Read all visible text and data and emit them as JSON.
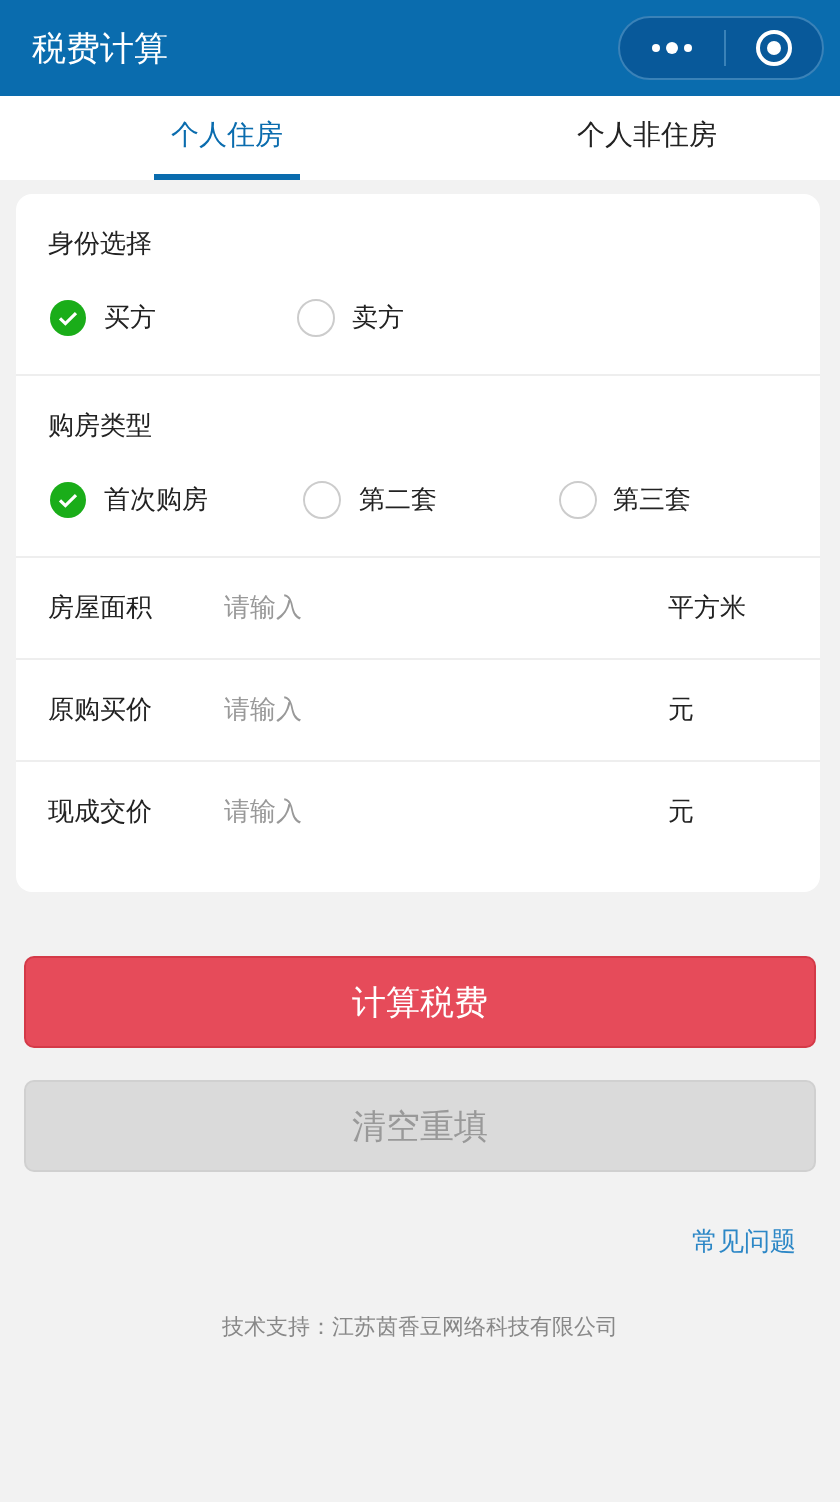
{
  "header": {
    "title": "税费计算"
  },
  "tabs": [
    {
      "label": "个人住房",
      "selected": true
    },
    {
      "label": "个人非住房",
      "selected": false
    }
  ],
  "radio_groups": [
    {
      "title": "身份选择",
      "options": [
        {
          "label": "买方",
          "selected": true
        },
        {
          "label": "卖方",
          "selected": false
        }
      ]
    },
    {
      "title": "购房类型",
      "options": [
        {
          "label": "首次购房",
          "selected": true
        },
        {
          "label": "第二套",
          "selected": false
        },
        {
          "label": "第三套",
          "selected": false
        }
      ]
    }
  ],
  "fields": [
    {
      "label": "房屋面积",
      "placeholder": "请输入",
      "unit": "平方米"
    },
    {
      "label": "原购买价",
      "placeholder": "请输入",
      "unit": "元"
    },
    {
      "label": "现成交价",
      "placeholder": "请输入",
      "unit": "元"
    }
  ],
  "buttons": [
    {
      "label": "计算税费",
      "disabled": false
    },
    {
      "label": "清空重填",
      "disabled": true
    }
  ],
  "faq_link": "常见问题",
  "footer": "技术支持：江苏茵香豆网络科技有限公司"
}
